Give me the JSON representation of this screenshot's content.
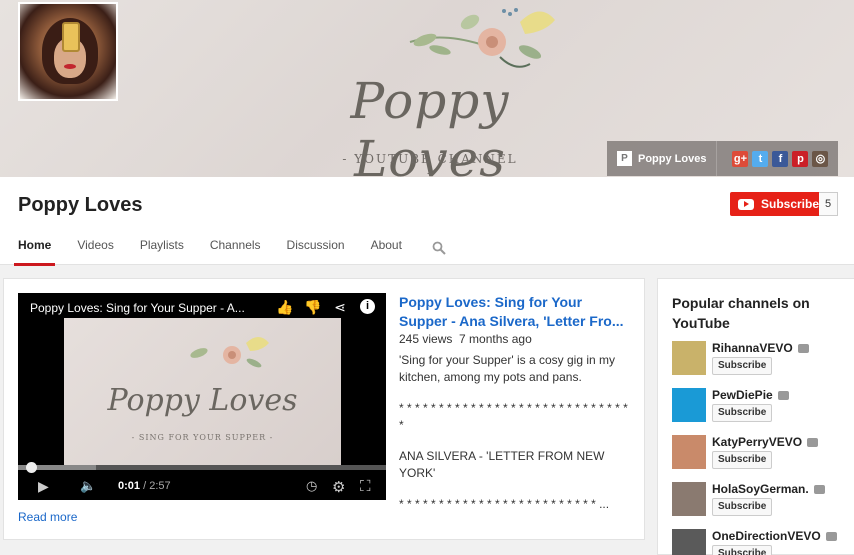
{
  "banner": {
    "title": "Poppy Loves",
    "subtitle": "- YOUTUBE CHANNEL -",
    "channel_link": "Poppy Loves",
    "social": [
      {
        "icon": "google-plus-icon",
        "glyph": "g+",
        "color": "#dd4b39"
      },
      {
        "icon": "twitter-icon",
        "glyph": "t",
        "color": "#55acee"
      },
      {
        "icon": "facebook-icon",
        "glyph": "f",
        "color": "#3b5998"
      },
      {
        "icon": "pinterest-icon",
        "glyph": "p",
        "color": "#cb2027"
      },
      {
        "icon": "instagram-icon",
        "glyph": "◎",
        "color": "#6b5647"
      }
    ]
  },
  "channel": {
    "name": "Poppy Loves",
    "subscribe_label": "Subscribe",
    "subscriber_count": "5"
  },
  "tabs": [
    {
      "label": "Home",
      "active": true
    },
    {
      "label": "Videos"
    },
    {
      "label": "Playlists"
    },
    {
      "label": "Channels"
    },
    {
      "label": "Discussion"
    },
    {
      "label": "About"
    }
  ],
  "player": {
    "title": "Poppy Loves: Sing for Your Supper - A...",
    "frame_title": "Poppy Loves",
    "frame_subtitle": "- SING FOR YOUR SUPPER -",
    "time_current": "0:01",
    "time_total": "/ 2:57",
    "progress": 0.01
  },
  "video": {
    "title": "Poppy Loves: Sing for Your Supper - Ana Silvera, 'Letter Fro...",
    "views": "245 views",
    "age": "7 months ago",
    "desc": [
      "'Sing for your Supper' is a cosy gig in my kitchen, among my pots and pans.",
      "* * * * * * * * * * * * * * * * * * * * * * * * * * * * * *",
      "ANA SILVERA - 'LETTER FROM NEW YORK'",
      "* * * * * * * * * * * * * * * * * * * * * * * * * ..."
    ],
    "read_more": "Read more"
  },
  "sidebar": {
    "title": "Popular channels on YouTube",
    "channels": [
      {
        "name": "RihannaVEVO",
        "subscribe": "Subscribe",
        "thumb_color": "#c9b26a"
      },
      {
        "name": "PewDiePie",
        "subscribe": "Subscribe",
        "thumb_color": "#1a9ad6"
      },
      {
        "name": "KatyPerryVEVO",
        "subscribe": "Subscribe",
        "thumb_color": "#c98a6a"
      },
      {
        "name": "HolaSoyGerman.",
        "subscribe": "Subscribe",
        "thumb_color": "#8a7a70"
      },
      {
        "name": "OneDirectionVEVO",
        "subscribe": "Subscribe",
        "thumb_color": "#5a5a5a"
      }
    ]
  }
}
